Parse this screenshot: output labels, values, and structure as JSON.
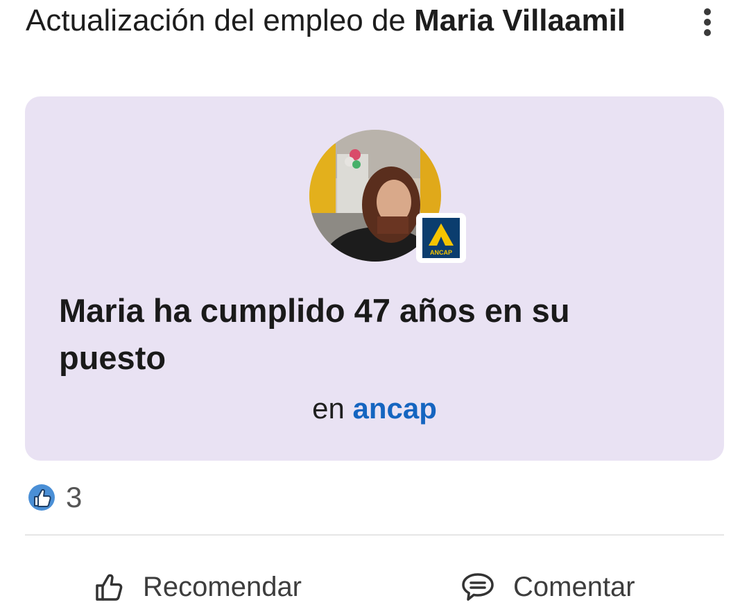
{
  "post": {
    "header_prefix": "Actualización del empleo de ",
    "member_name": "Maria Villaamil",
    "more_icon": "more-vertical-icon"
  },
  "card": {
    "background": "#e9e2f3",
    "avatar_alt": "Maria Villaamil",
    "company_logo_text": "ANCAP",
    "company_logo_color": "#0b3d6e",
    "company_logo_accent": "#f5c400",
    "headline": "Maria ha cumplido 47 años en su puesto",
    "company_prefix": "en",
    "company_name": "ancap",
    "link_color": "#1565c0"
  },
  "social": {
    "reaction_icon": "like-reaction-icon",
    "reaction_count": "3"
  },
  "actions": {
    "recommend_label": "Recomendar",
    "recommend_icon": "thumbs-up-outline-icon",
    "comment_label": "Comentar",
    "comment_icon": "speech-bubble-icon"
  }
}
